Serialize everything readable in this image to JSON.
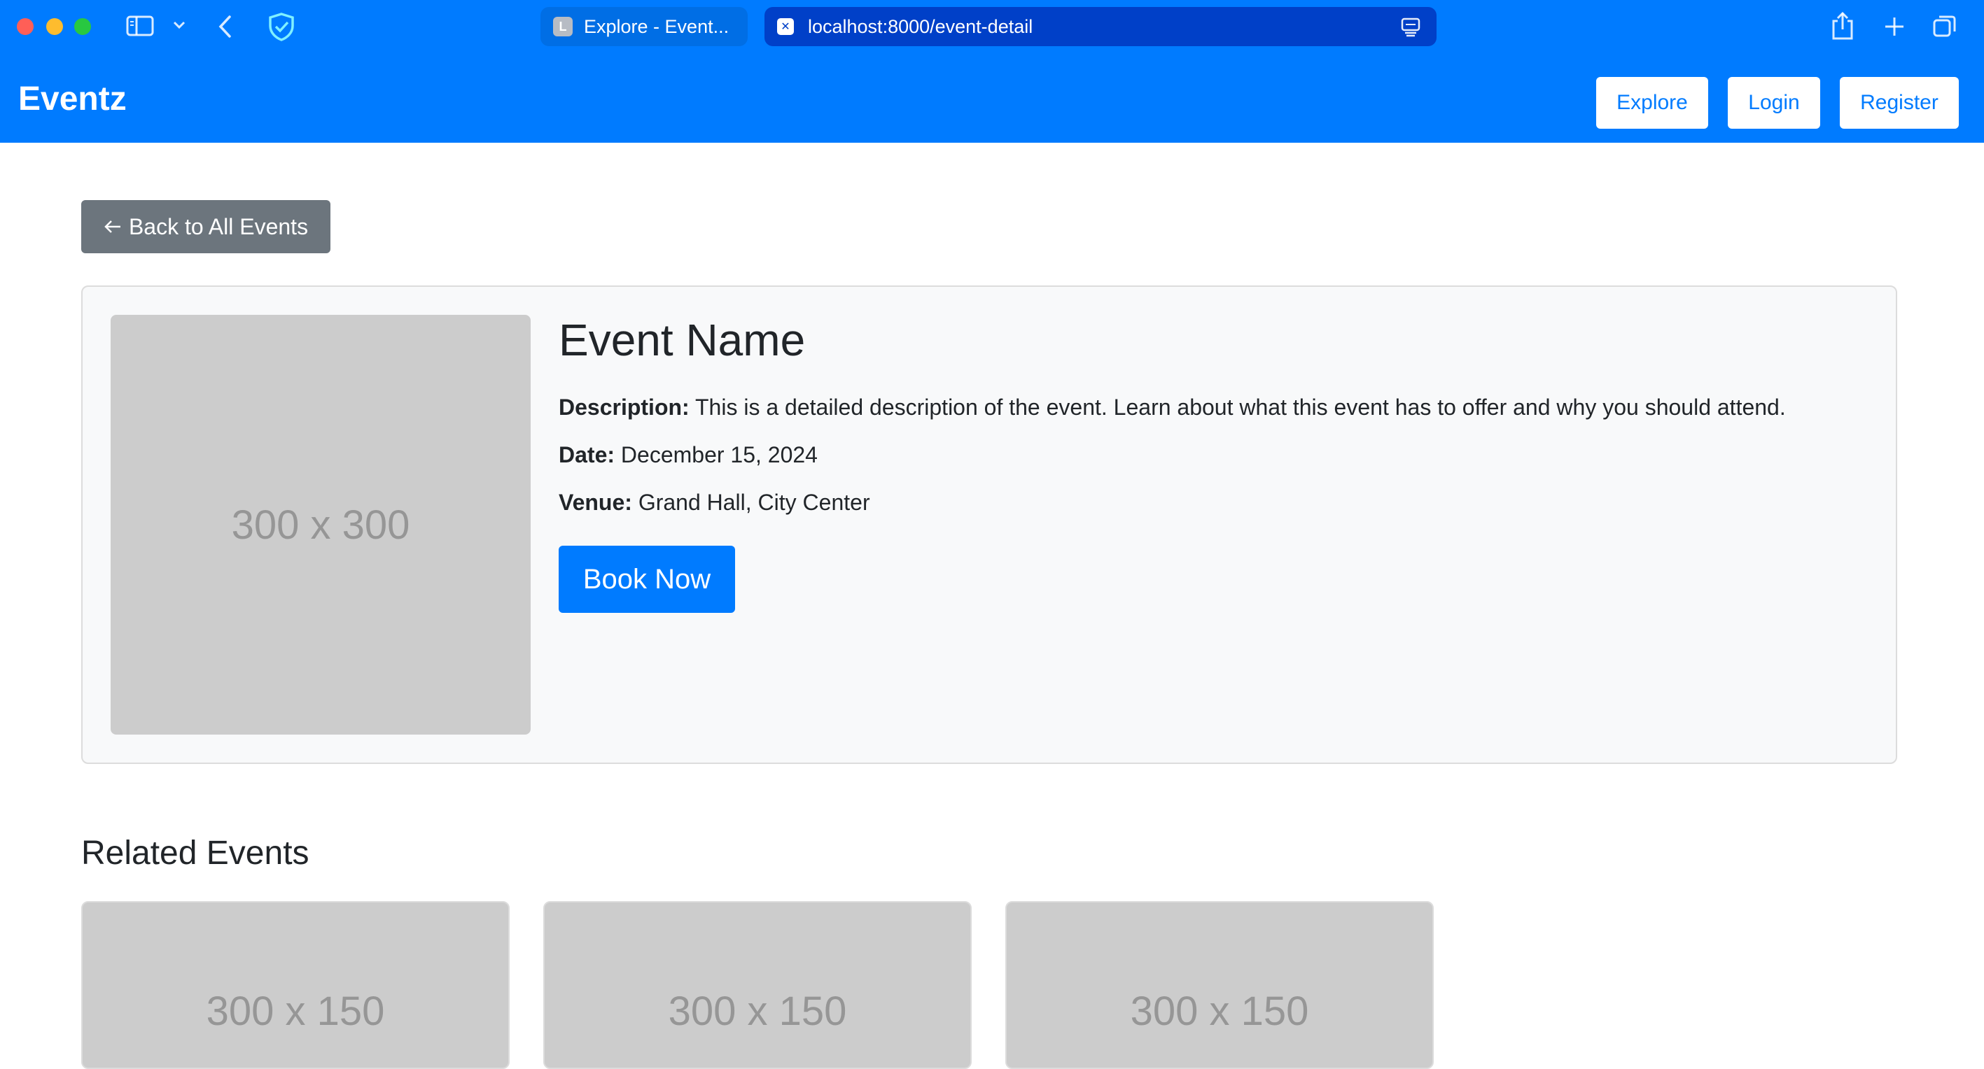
{
  "browser": {
    "tabs": [
      {
        "label": "Explore - Event...",
        "favicon_letter": "L"
      },
      {
        "label": "localhost:8000/event-detail",
        "favicon_letter": "✕"
      }
    ],
    "icons": [
      "sidebar-icon",
      "chevron-down-icon",
      "back-icon",
      "shield-icon",
      "reader-icon",
      "share-icon",
      "plus-icon",
      "tabs-icon"
    ]
  },
  "navbar": {
    "brand": "Eventz",
    "links": [
      "Explore",
      "Login",
      "Register"
    ]
  },
  "back_button": {
    "label": "Back to All Events",
    "icon": "arrow-left-icon"
  },
  "event": {
    "image_placeholder": "300 x 300",
    "title": "Event Name",
    "description_label": "Description:",
    "description": "This is a detailed description of the event. Learn about what this event has to offer and why you should attend.",
    "date_label": "Date:",
    "date": "December 15, 2024",
    "venue_label": "Venue:",
    "venue": "Grand Hall, City Center",
    "book_label": "Book Now"
  },
  "related": {
    "title": "Related Events",
    "cards": [
      {
        "image_placeholder": "300 x 150"
      },
      {
        "image_placeholder": "300 x 150"
      },
      {
        "image_placeholder": "300 x 150"
      }
    ]
  },
  "colors": {
    "primary": "#007bff",
    "secondary": "#6c757d",
    "placeholder": "#cccccc",
    "card_bg": "#f8f9fa"
  }
}
